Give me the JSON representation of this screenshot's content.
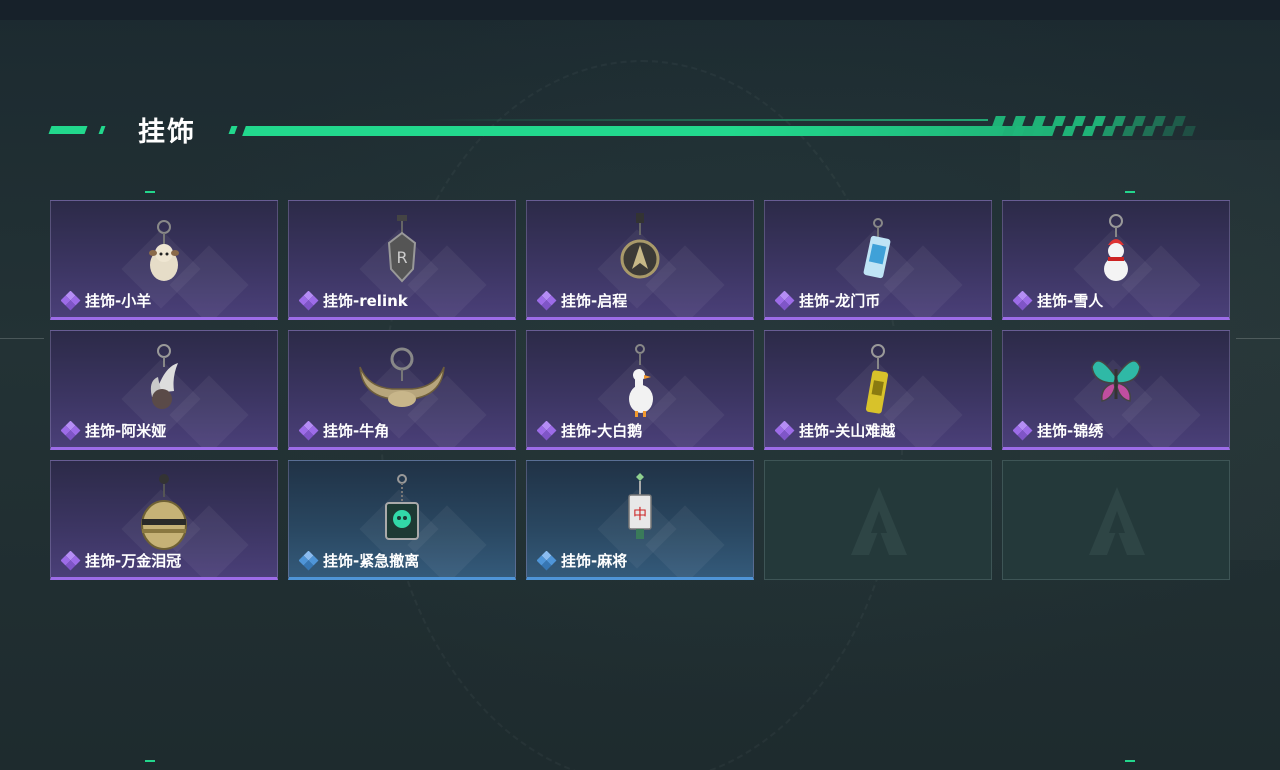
{
  "section": {
    "title": "挂饰"
  },
  "colors": {
    "accent": "#22d88d",
    "purple_rarity": "#9d6ce8",
    "blue_rarity": "#4f95d8"
  },
  "items": [
    {
      "label": "挂饰-小羊",
      "rarity": "purple",
      "icon": "lamb-charm-icon"
    },
    {
      "label": "挂饰-relink",
      "rarity": "purple",
      "icon": "relink-charm-icon"
    },
    {
      "label": "挂饰-启程",
      "rarity": "purple",
      "icon": "departure-charm-icon"
    },
    {
      "label": "挂饰-龙门币",
      "rarity": "purple",
      "icon": "longmen-coin-charm-icon"
    },
    {
      "label": "挂饰-雪人",
      "rarity": "purple",
      "icon": "snowman-charm-icon"
    },
    {
      "label": "挂饰-阿米娅",
      "rarity": "purple",
      "icon": "amiya-charm-icon"
    },
    {
      "label": "挂饰-牛角",
      "rarity": "purple",
      "icon": "bull-horn-charm-icon"
    },
    {
      "label": "挂饰-大白鹅",
      "rarity": "purple",
      "icon": "white-goose-charm-icon"
    },
    {
      "label": "挂饰-关山难越",
      "rarity": "purple",
      "icon": "battery-charm-icon"
    },
    {
      "label": "挂饰-锦绣",
      "rarity": "purple",
      "icon": "butterfly-charm-icon"
    },
    {
      "label": "挂饰-万金泪冠",
      "rarity": "purple",
      "icon": "golden-crown-charm-icon"
    },
    {
      "label": "挂饰-紧急撤离",
      "rarity": "blue",
      "icon": "emergency-evac-charm-icon"
    },
    {
      "label": "挂饰-麻将",
      "rarity": "blue",
      "icon": "mahjong-charm-icon"
    }
  ],
  "empty_slots": 2
}
